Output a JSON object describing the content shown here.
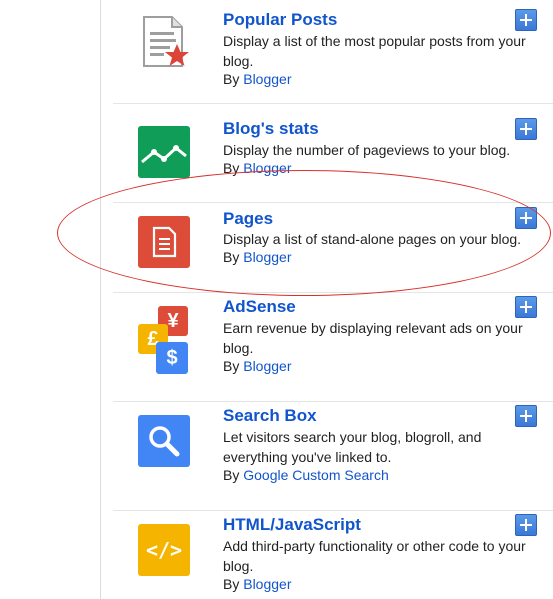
{
  "gadgets": [
    {
      "title": "Popular Posts",
      "desc": "Display a list of the most popular posts from your blog.",
      "by": "By",
      "author": "Blogger",
      "icon": "popular-posts-icon"
    },
    {
      "title": "Blog's stats",
      "desc": "Display the number of pageviews to your blog.",
      "by": "By",
      "author": "Blogger",
      "icon": "stats-chart-icon"
    },
    {
      "title": "Pages",
      "desc": "Display a list of stand-alone pages on your blog.",
      "by": "By",
      "author": "Blogger",
      "icon": "pages-document-icon"
    },
    {
      "title": "AdSense",
      "desc": "Earn revenue by displaying relevant ads on your blog.",
      "by": "By",
      "author": "Blogger",
      "icon": "adsense-currency-icon"
    },
    {
      "title": "Search Box",
      "desc": "Let visitors search your blog, blogroll, and everything you've linked to.",
      "by": "By",
      "author": "Google Custom Search",
      "icon": "search-magnifier-icon"
    },
    {
      "title": "HTML/JavaScript",
      "desc": "Add third-party functionality or other code to your blog.",
      "by": "By",
      "author": "Blogger",
      "icon": "code-brackets-icon"
    }
  ],
  "colors": {
    "link": "#1155cc",
    "stats_green": "#0f9d58",
    "pages_red": "#dd4b39",
    "adsense_red": "#dd4b39",
    "adsense_yellow": "#f4b400",
    "adsense_blue": "#4285f4",
    "search_blue": "#4285f4",
    "html_yellow": "#f4b400",
    "highlight": "#d9302c"
  },
  "adsense_symbols": {
    "yen": "¥",
    "pound": "£",
    "dollar": "$"
  },
  "html_symbol": "</>"
}
